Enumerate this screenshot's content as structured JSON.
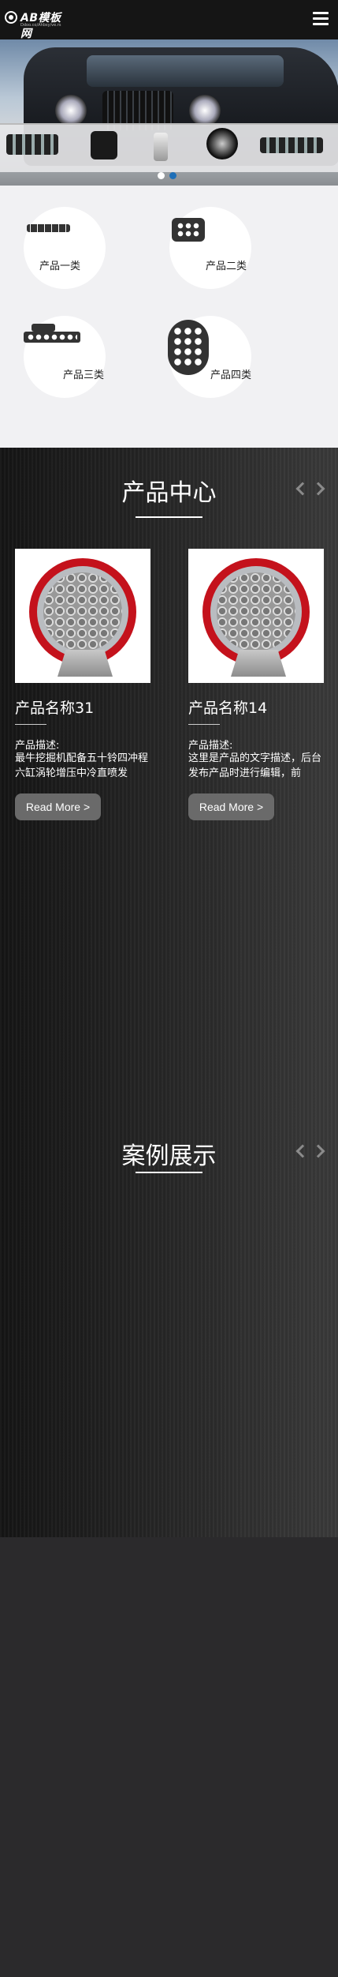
{
  "header": {
    "logo_text": "AB模板网",
    "logo_sub": "Ddoo.co/Ahbsy/ve.rs"
  },
  "banner": {
    "active_slide": 2,
    "slide_count": 2,
    "colors": {
      "dot_inactive": "#ffffff",
      "dot_active": "#1e6fb8"
    }
  },
  "categories": [
    {
      "label": "产品一类",
      "icon": "light-bar-icon"
    },
    {
      "label": "产品二类",
      "icon": "square-lamp-icon"
    },
    {
      "label": "产品三类",
      "icon": "led-strip-icon"
    },
    {
      "label": "产品四类",
      "icon": "round-lamp-icon"
    }
  ],
  "products_section": {
    "title": "产品中心",
    "items": [
      {
        "name": "产品名称31",
        "desc_label": "产品描述:",
        "desc": "最牛挖掘机配备五十铃四冲程六缸涡轮增压中冷直喷发",
        "button": "Read More >"
      },
      {
        "name": "产品名称14",
        "desc_label": "产品描述:",
        "desc": "这里是产品的文字描述，后台发布产品时进行编辑，前",
        "button": "Read More >"
      }
    ]
  },
  "cases_section": {
    "title": "案例展示"
  }
}
